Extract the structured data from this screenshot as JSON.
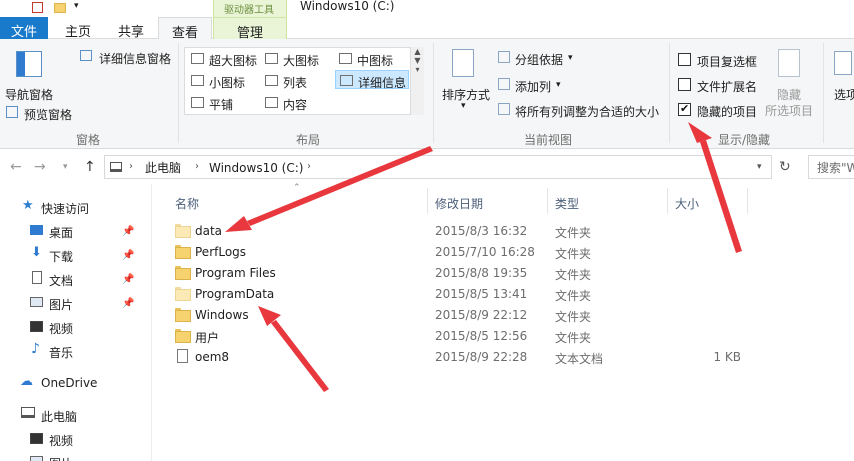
{
  "window": {
    "title": "Windows10 (C:)",
    "tool_context": "驱动器工具"
  },
  "tabs": [
    {
      "label": "文件"
    },
    {
      "label": "主页"
    },
    {
      "label": "共享"
    },
    {
      "label": "查看"
    },
    {
      "label": "管理"
    }
  ],
  "ribbon": {
    "panes": {
      "nav_pane": "导航窗格",
      "preview_pane": "预览窗格",
      "details_pane": "详细信息窗格",
      "group_label": "窗格"
    },
    "layout": {
      "items": [
        "超大图标",
        "大图标",
        "中图标",
        "小图标",
        "列表",
        "详细信息",
        "平铺",
        "内容"
      ],
      "selected": "详细信息",
      "group_label": "布局"
    },
    "current_view": {
      "sort_by": "排序方式",
      "group_by": "分组依据",
      "add_columns": "添加列",
      "fit_columns": "将所有列调整为合适的大小",
      "group_label": "当前视图"
    },
    "show_hide": {
      "item_checkboxes": {
        "label": "项目复选框",
        "checked": false
      },
      "file_extensions": {
        "label": "文件扩展名",
        "checked": false
      },
      "hidden_items": {
        "label": "隐藏的项目",
        "checked": true
      },
      "hide_selected": "隐藏",
      "hide_selected_2": "所选项目",
      "group_label": "显示/隐藏"
    },
    "options": "选项"
  },
  "address": {
    "path": [
      "此电脑",
      "Windows10 (C:)"
    ],
    "search_placeholder": "搜索\"W"
  },
  "nav": {
    "quick_access": "快速访问",
    "items": [
      "桌面",
      "下载",
      "文档",
      "图片",
      "视频",
      "音乐"
    ],
    "onedrive": "OneDrive",
    "this_pc": "此电脑",
    "pc_items": [
      "视频",
      "图片"
    ]
  },
  "columns": {
    "name": "名称",
    "date": "修改日期",
    "type": "类型",
    "size": "大小"
  },
  "files": [
    {
      "name": "data",
      "date": "2015/8/3 16:32",
      "type": "文件夹",
      "size": ""
    },
    {
      "name": "PerfLogs",
      "date": "2015/7/10 16:28",
      "type": "文件夹",
      "size": ""
    },
    {
      "name": "Program Files",
      "date": "2015/8/8 19:35",
      "type": "文件夹",
      "size": ""
    },
    {
      "name": "ProgramData",
      "date": "2015/8/5 13:41",
      "type": "文件夹",
      "size": ""
    },
    {
      "name": "Windows",
      "date": "2015/8/9 22:12",
      "type": "文件夹",
      "size": ""
    },
    {
      "name": "用户",
      "date": "2015/8/5 12:56",
      "type": "文件夹",
      "size": ""
    },
    {
      "name": "oem8",
      "date": "2015/8/9 22:28",
      "type": "文本文档",
      "size": "1 KB"
    }
  ],
  "colors": {
    "accent": "#1979ca",
    "annotation_arrow": "#e8383d",
    "selected_bg": "#cce8ff"
  }
}
